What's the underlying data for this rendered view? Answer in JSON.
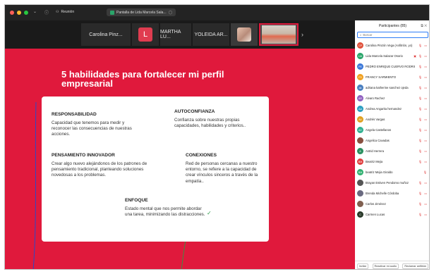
{
  "titlebar": {
    "meeting_label": "Reunión",
    "share_label": "Pantalla de Lida Marcela Sala..."
  },
  "strip": {
    "tiles": [
      {
        "label": "Carolina Pinz..."
      },
      {
        "initial": "L"
      },
      {
        "label": "MARTHA LU..."
      },
      {
        "label": "YOLEIDA AR..."
      }
    ],
    "next_icon": "chevron-right-icon"
  },
  "slide": {
    "title": "5 habilidades para fortalecer mi perfil empresarial",
    "sections": [
      {
        "heading": "RESPONSABILIDAD",
        "text": "Capacidad que tenemos para medir y reconocer las consecuencias de nuestras acciones."
      },
      {
        "heading": "AUTOCONFIANZA",
        "text": "Confianza sobre nuestras propias capacidades, habilidades y criterios.."
      },
      {
        "heading": "PENSAMIENTO INNOVADOR",
        "text": "Crear algo nuevo alejándonos de los patrones de pensamiento tradicional, planteando soluciones novedosas a los problemas."
      },
      {
        "heading": "CONEXIONES",
        "text": "Red de personas cercanas a nuestro entorno, se refiere a la capacidad de crear vínculos sinceros a través de la empatía.."
      },
      {
        "heading": "ENFOQUE",
        "text": "Estado mental que nos permite abordar una tarea, minimizando las distracciones."
      }
    ],
    "check_mark": "✓"
  },
  "panel": {
    "title": "Participantes (85)",
    "search_placeholder": "Buscar",
    "participants": [
      {
        "initials": "CP",
        "name": "Carolina Pinzón Vega (Anfitrión, yo)",
        "color": "#e0523c",
        "icons": "🎙 ▭"
      },
      {
        "initials": "LM",
        "name": "Lida Marcela Salazar Osorio",
        "color": "#2aa56a",
        "icons": "▣ 🎙 ▭"
      },
      {
        "initials": "PE",
        "name": "PEDRO ENRIQUE CUERVO RODRIGU...",
        "color": "#3c78d8",
        "icons": "🎙 ▭"
      },
      {
        "initials": "FS",
        "name": "FRANCY SARMIENTO",
        "color": "#f0a020",
        "icons": "🎙 ▭"
      },
      {
        "initials": "ak",
        "name": "adriana katherine sanchez ojeda",
        "color": "#4a7fc0",
        "icons": "🎙 ▭"
      },
      {
        "initials": "AR",
        "name": "Alvaro Rachez",
        "color": "#9060c0",
        "icons": "🎙 ▭"
      },
      {
        "initials": "AA",
        "name": "Andrea Angarita hernandez",
        "color": "#2a9ec0",
        "icons": "🎙 ▭"
      },
      {
        "initials": "AV",
        "name": "Andrés Vargas",
        "color": "#e0a020",
        "icons": "🎙 ▭"
      },
      {
        "initials": "AC",
        "name": "Angela Castellanos",
        "color": "#30b090",
        "icons": "🎙 ▭"
      },
      {
        "initials": "",
        "name": "Angelica Cavadas",
        "color": "#8a5040",
        "icons": "🎙 ▭"
      },
      {
        "initials": "A",
        "name": "Astrid Herrera",
        "color": "#2a9060",
        "icons": "🎙 ▭"
      },
      {
        "initials": "BM",
        "name": "Beatriz Mejia",
        "color": "#e04040",
        "icons": "🎙 ▭"
      },
      {
        "initials": "BM",
        "name": "beatriz Mejia Giraldo",
        "color": "#30b070",
        "icons": "🎙"
      },
      {
        "initials": "",
        "name": "Brayan Estiven Pendomo muñoz",
        "color": "#555555",
        "icons": "🎙 ▭"
      },
      {
        "initials": "",
        "name": "Brenda Michelle Córdoba",
        "color": "#6a6a80",
        "icons": "🎙 ▭"
      },
      {
        "initials": "",
        "name": "Carlos Jiménez",
        "color": "#806050",
        "icons": "🎙 ▭"
      },
      {
        "initials": "C",
        "name": "Carmen Lucas",
        "color": "#2a3a2a",
        "icons": "🎙 ▭"
      }
    ],
    "footer": {
      "invite": "Invitar",
      "unmute": "Reactivar mi audio",
      "claim_host": "Reclamar anfitrión"
    }
  }
}
